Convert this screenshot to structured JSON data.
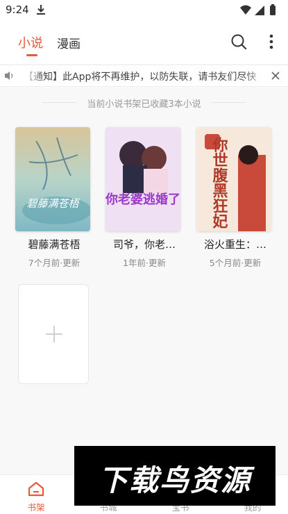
{
  "status_bar": {
    "time": "9:24",
    "icons": [
      "download-icon",
      "wifi-icon",
      "signal-icon",
      "battery-icon"
    ]
  },
  "header": {
    "tabs": [
      {
        "label": "小说",
        "active": true
      },
      {
        "label": "漫画",
        "active": false
      }
    ],
    "icons": [
      "search-icon",
      "more-icon"
    ]
  },
  "notice": {
    "text": "【通知】此App将不再维护，以防失联，请书友们尽快",
    "icons": [
      "speaker-icon",
      "close-icon"
    ]
  },
  "shelf": {
    "summary": "当前小说书架已收藏3本小说",
    "books": [
      {
        "title": "碧藤满苍梧",
        "meta": "7个月前·更新",
        "cover_text": "碧藤满苍梧"
      },
      {
        "title": "司爷，你老…",
        "meta": "1年前·更新",
        "cover_text": "你老婆逃婚了"
      },
      {
        "title": "浴火重生：…",
        "meta": "5个月前·更新",
        "cover_text": "你世腹黑狂妃"
      }
    ],
    "add_icon": "plus-icon"
  },
  "bottom_nav": {
    "items": [
      {
        "label": "书架",
        "icon": "home-icon",
        "active": true
      },
      {
        "label": "书城",
        "active": false
      },
      {
        "label": "宝书",
        "active": false
      },
      {
        "label": "我的",
        "active": false
      }
    ]
  },
  "watermark": {
    "text": "下载鸟资源"
  },
  "colors": {
    "accent": "#e8593a",
    "background": "#f8f8f8"
  }
}
